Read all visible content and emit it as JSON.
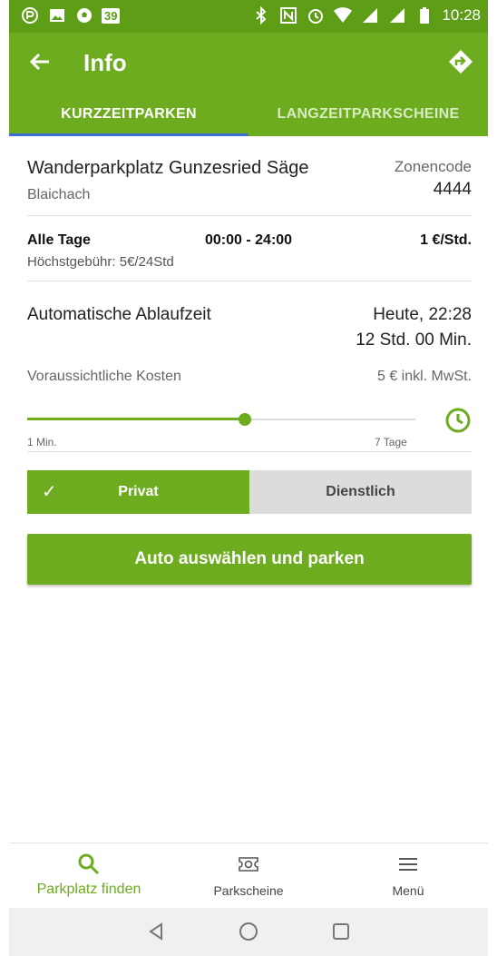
{
  "status_bar": {
    "notification_count": "39",
    "time": "10:28"
  },
  "app_bar": {
    "title": "Info"
  },
  "tabs": [
    {
      "label": "KURZZEITPARKEN",
      "active": true
    },
    {
      "label": "LANGZEITPARKSCHEINE",
      "active": false
    }
  ],
  "parking": {
    "name": "Wanderparkplatz Gunzesried Säge",
    "city": "Blaichach",
    "zone_label": "Zonencode",
    "zone_code": "4444"
  },
  "tariff": {
    "days": "Alle Tage",
    "hours": "00:00 - 24:00",
    "price": "1 €/Std.",
    "max_fee": "Höchstgebühr: 5€/24Std"
  },
  "expiry": {
    "label": "Automatische Ablaufzeit",
    "day_time": "Heute, 22:28",
    "duration": "12 Std. 00 Min.",
    "cost_label": "Voraussichtliche Kosten",
    "cost_value": "5 € inkl. MwSt.",
    "slider_level": 0.56,
    "slider_min_label": "1 Min.",
    "slider_max_label": "7 Tage"
  },
  "mode_toggle": {
    "private_label": "Privat",
    "business_label": "Dienstlich",
    "selected": "private"
  },
  "action_button": {
    "label": "Auto auswählen und parken"
  },
  "bottom_nav": [
    {
      "label": "Parkplatz finden",
      "icon": "search-icon",
      "active": true
    },
    {
      "label": "Parkscheine",
      "icon": "ticket-icon",
      "active": false
    },
    {
      "label": "Menü",
      "icon": "menu-icon",
      "active": false
    }
  ],
  "colors": {
    "primary": "#6cac1e",
    "status_bar": "#5d9e16",
    "tab_indicator": "#3b6fd1"
  }
}
